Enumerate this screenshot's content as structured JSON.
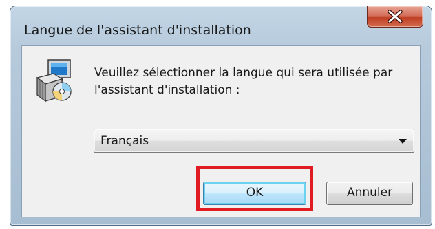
{
  "window": {
    "title": "Langue de l'assistant d'installation"
  },
  "titlebar": {
    "close_icon": "close-x-icon"
  },
  "content": {
    "icon": "installer-package-icon",
    "prompt": "Veuillez sélectionner la langue qui sera utilisée par l'assistant d'installation :"
  },
  "language_select": {
    "value": "Français"
  },
  "buttons": {
    "ok_label": "OK",
    "cancel_label": "Annuler"
  },
  "annotation": {
    "highlight_color": "#e01b24",
    "highlight_target": "ok-button"
  }
}
